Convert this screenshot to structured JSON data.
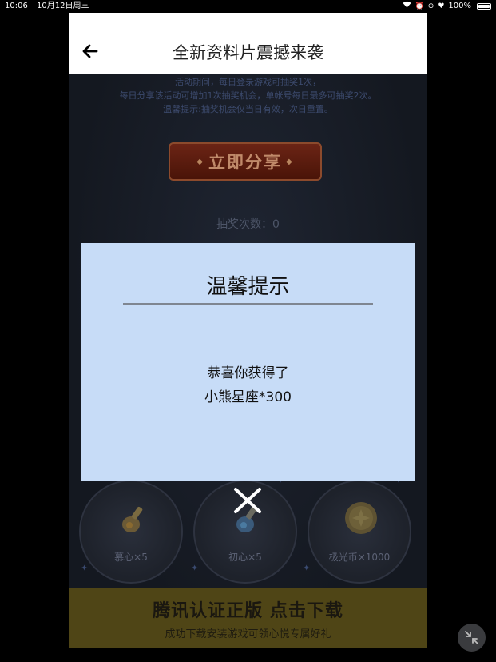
{
  "status_bar": {
    "time": "10:06",
    "date": "10月12日周三",
    "battery": "100%"
  },
  "header": {
    "title": "全新资料片震撼来袭"
  },
  "rules": {
    "line1": "活动期间，每日登录游戏可抽奖1次，",
    "line2": "每日分享该活动可增加1次抽奖机会，单帐号每日最多可抽奖2次。",
    "line3": "温馨提示:抽奖机会仅当日有效，次日重置。"
  },
  "share_button": {
    "label": "立即分享"
  },
  "draw_count": "抽奖次数：0",
  "prizes": [
    {
      "label": "慕心×5",
      "icon": "elixir-bottle-icon"
    },
    {
      "label": "初心×5",
      "icon": "blue-bottle-icon"
    },
    {
      "label": "极光币×1000",
      "icon": "coin-icon"
    }
  ],
  "download": {
    "title": "腾讯认证正版 点击下载",
    "subtitle": "成功下载安装游戏可领心悦专属好礼"
  },
  "modal": {
    "title": "温馨提示",
    "message_line1": "恭喜你获得了",
    "message_line2": "小熊星座*300"
  },
  "colors": {
    "modal_bg": "#c7dcf7",
    "download_bar": "#4f4516",
    "share_button": "#6b2415"
  }
}
